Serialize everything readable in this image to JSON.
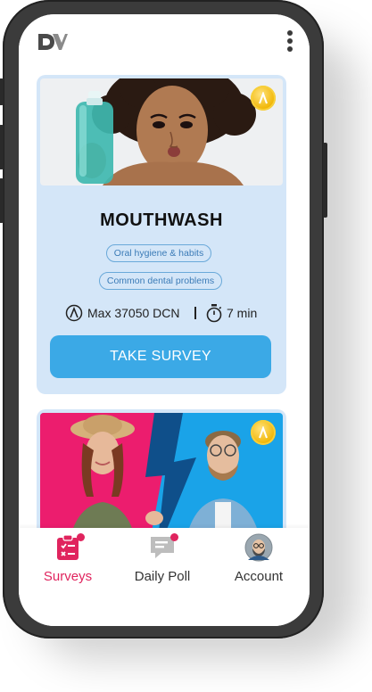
{
  "app": {
    "logo_text": "DV"
  },
  "survey_cards": [
    {
      "title": "MOUTHWASH",
      "tags": [
        "Oral hygiene & habits",
        "Common dental problems"
      ],
      "reward": "Max 37050 DCN",
      "duration": "7 min",
      "cta": "TAKE SURVEY"
    }
  ],
  "nav": {
    "items": [
      {
        "label": "Surveys",
        "icon": "survey-list-icon",
        "active": true
      },
      {
        "label": "Daily Poll",
        "icon": "poll-chat-icon"
      },
      {
        "label": "Account",
        "icon": "avatar-icon"
      }
    ]
  },
  "colors": {
    "accent": "#3ba9e6",
    "card_bg": "#d4e6f8",
    "active_nav": "#e0245e",
    "coin": "#f0b400"
  }
}
